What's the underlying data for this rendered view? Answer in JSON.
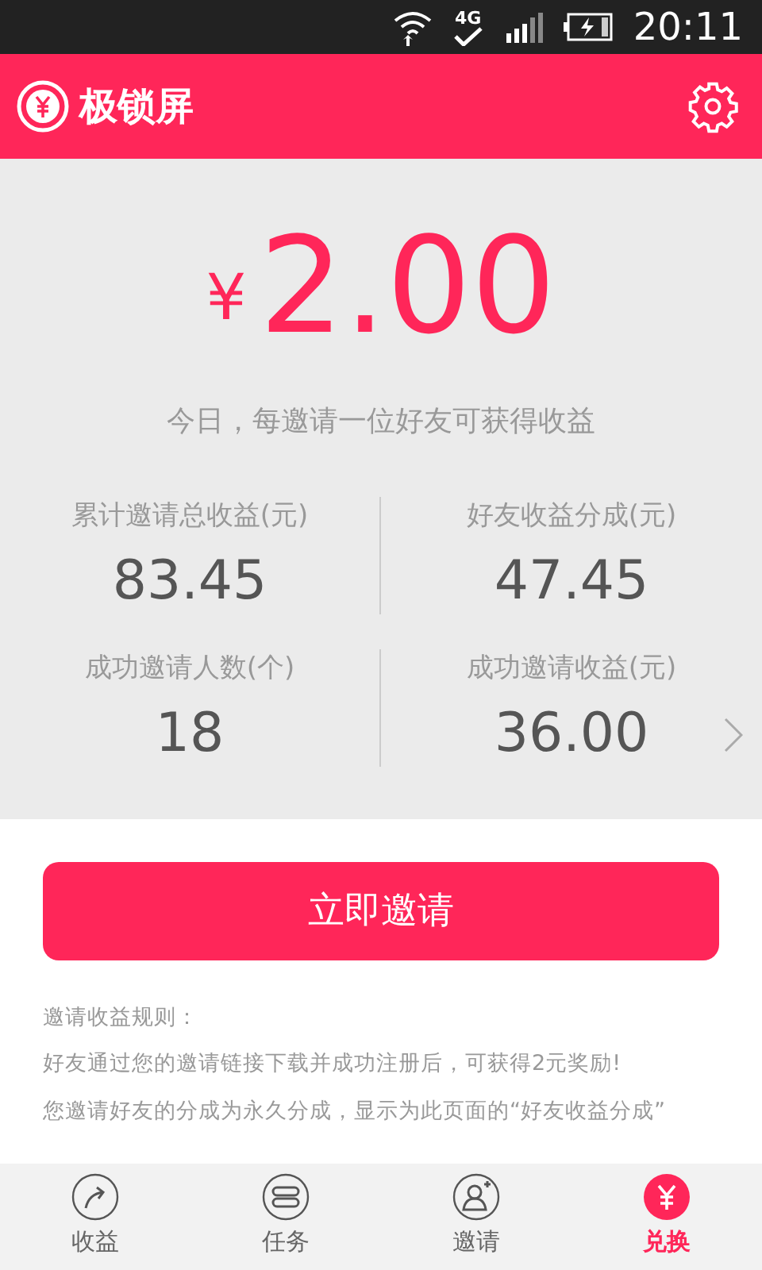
{
  "status_bar": {
    "network": "4G",
    "time": "20:11"
  },
  "header": {
    "title": "极锁屏"
  },
  "reward": {
    "currency": "¥",
    "amount": "2.00",
    "caption": "今日，每邀请一位好友可获得收益"
  },
  "stats": [
    {
      "label": "累计邀请总收益(元)",
      "value": "83.45"
    },
    {
      "label": "好友收益分成(元)",
      "value": "47.45"
    },
    {
      "label": "成功邀请人数(个)",
      "value": "18"
    },
    {
      "label": "成功邀请收益(元)",
      "value": "36.00"
    }
  ],
  "invite_button": "立即邀请",
  "rules": [
    "邀请收益规则：",
    "好友通过您的邀请链接下载并成功注册后，可获得2元奖励!",
    "您邀请好友的分成为永久分成，显示为此页面的“好友收益分成”"
  ],
  "nav": [
    {
      "kind": "earnings",
      "label": "收益",
      "selected": false
    },
    {
      "kind": "tasks",
      "label": "任务",
      "selected": false
    },
    {
      "kind": "invite",
      "label": "邀请",
      "selected": false
    },
    {
      "kind": "exchange",
      "label": "兑换",
      "selected": true
    }
  ]
}
